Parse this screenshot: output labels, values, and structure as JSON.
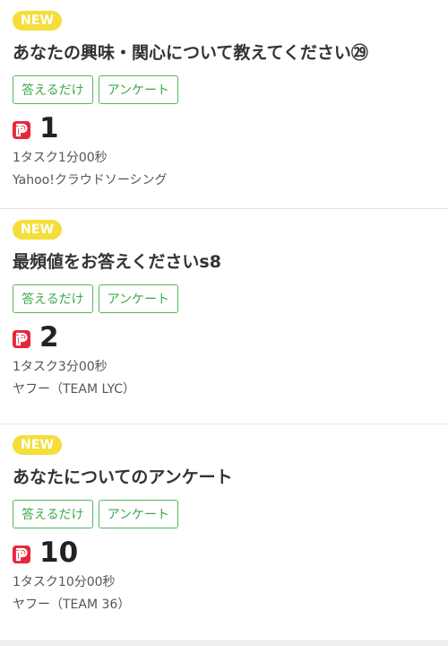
{
  "tasks": [
    {
      "badge": "NEW",
      "title": "あなたの興味・関心について教えてください㉙",
      "tags": [
        "答えるだけ",
        "アンケート"
      ],
      "reward_icon": "paypay-icon",
      "reward": "1",
      "duration": "1タスク1分00秒",
      "provider": "Yahoo!クラウドソーシング"
    },
    {
      "badge": "NEW",
      "title": "最頻値をお答えくださいs8",
      "tags": [
        "答えるだけ",
        "アンケート"
      ],
      "reward_icon": "paypay-icon",
      "reward": "2",
      "duration": "1タスク3分00秒",
      "provider": "ヤフー（TEAM LYC）"
    },
    {
      "badge": "NEW",
      "title": "あなたについてのアンケート",
      "tags": [
        "答えるだけ",
        "アンケート"
      ],
      "reward_icon": "paypay-icon",
      "reward": "10",
      "duration": "1タスク10分00秒",
      "provider": "ヤフー（TEAM 36）"
    }
  ],
  "colors": {
    "badge": "#f5de3a",
    "tag_border": "#54b95a",
    "tag_text": "#3ea94a",
    "paypay": "#e8253a"
  }
}
